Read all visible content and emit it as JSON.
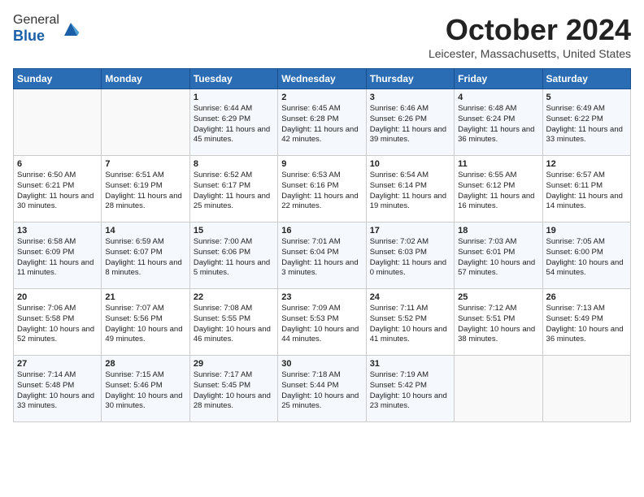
{
  "header": {
    "logo_general": "General",
    "logo_blue": "Blue",
    "month_title": "October 2024",
    "location": "Leicester, Massachusetts, United States"
  },
  "weekdays": [
    "Sunday",
    "Monday",
    "Tuesday",
    "Wednesday",
    "Thursday",
    "Friday",
    "Saturday"
  ],
  "weeks": [
    [
      {
        "day": "",
        "sunrise": "",
        "sunset": "",
        "daylight": ""
      },
      {
        "day": "",
        "sunrise": "",
        "sunset": "",
        "daylight": ""
      },
      {
        "day": "1",
        "sunrise": "Sunrise: 6:44 AM",
        "sunset": "Sunset: 6:29 PM",
        "daylight": "Daylight: 11 hours and 45 minutes."
      },
      {
        "day": "2",
        "sunrise": "Sunrise: 6:45 AM",
        "sunset": "Sunset: 6:28 PM",
        "daylight": "Daylight: 11 hours and 42 minutes."
      },
      {
        "day": "3",
        "sunrise": "Sunrise: 6:46 AM",
        "sunset": "Sunset: 6:26 PM",
        "daylight": "Daylight: 11 hours and 39 minutes."
      },
      {
        "day": "4",
        "sunrise": "Sunrise: 6:48 AM",
        "sunset": "Sunset: 6:24 PM",
        "daylight": "Daylight: 11 hours and 36 minutes."
      },
      {
        "day": "5",
        "sunrise": "Sunrise: 6:49 AM",
        "sunset": "Sunset: 6:22 PM",
        "daylight": "Daylight: 11 hours and 33 minutes."
      }
    ],
    [
      {
        "day": "6",
        "sunrise": "Sunrise: 6:50 AM",
        "sunset": "Sunset: 6:21 PM",
        "daylight": "Daylight: 11 hours and 30 minutes."
      },
      {
        "day": "7",
        "sunrise": "Sunrise: 6:51 AM",
        "sunset": "Sunset: 6:19 PM",
        "daylight": "Daylight: 11 hours and 28 minutes."
      },
      {
        "day": "8",
        "sunrise": "Sunrise: 6:52 AM",
        "sunset": "Sunset: 6:17 PM",
        "daylight": "Daylight: 11 hours and 25 minutes."
      },
      {
        "day": "9",
        "sunrise": "Sunrise: 6:53 AM",
        "sunset": "Sunset: 6:16 PM",
        "daylight": "Daylight: 11 hours and 22 minutes."
      },
      {
        "day": "10",
        "sunrise": "Sunrise: 6:54 AM",
        "sunset": "Sunset: 6:14 PM",
        "daylight": "Daylight: 11 hours and 19 minutes."
      },
      {
        "day": "11",
        "sunrise": "Sunrise: 6:55 AM",
        "sunset": "Sunset: 6:12 PM",
        "daylight": "Daylight: 11 hours and 16 minutes."
      },
      {
        "day": "12",
        "sunrise": "Sunrise: 6:57 AM",
        "sunset": "Sunset: 6:11 PM",
        "daylight": "Daylight: 11 hours and 14 minutes."
      }
    ],
    [
      {
        "day": "13",
        "sunrise": "Sunrise: 6:58 AM",
        "sunset": "Sunset: 6:09 PM",
        "daylight": "Daylight: 11 hours and 11 minutes."
      },
      {
        "day": "14",
        "sunrise": "Sunrise: 6:59 AM",
        "sunset": "Sunset: 6:07 PM",
        "daylight": "Daylight: 11 hours and 8 minutes."
      },
      {
        "day": "15",
        "sunrise": "Sunrise: 7:00 AM",
        "sunset": "Sunset: 6:06 PM",
        "daylight": "Daylight: 11 hours and 5 minutes."
      },
      {
        "day": "16",
        "sunrise": "Sunrise: 7:01 AM",
        "sunset": "Sunset: 6:04 PM",
        "daylight": "Daylight: 11 hours and 3 minutes."
      },
      {
        "day": "17",
        "sunrise": "Sunrise: 7:02 AM",
        "sunset": "Sunset: 6:03 PM",
        "daylight": "Daylight: 11 hours and 0 minutes."
      },
      {
        "day": "18",
        "sunrise": "Sunrise: 7:03 AM",
        "sunset": "Sunset: 6:01 PM",
        "daylight": "Daylight: 10 hours and 57 minutes."
      },
      {
        "day": "19",
        "sunrise": "Sunrise: 7:05 AM",
        "sunset": "Sunset: 6:00 PM",
        "daylight": "Daylight: 10 hours and 54 minutes."
      }
    ],
    [
      {
        "day": "20",
        "sunrise": "Sunrise: 7:06 AM",
        "sunset": "Sunset: 5:58 PM",
        "daylight": "Daylight: 10 hours and 52 minutes."
      },
      {
        "day": "21",
        "sunrise": "Sunrise: 7:07 AM",
        "sunset": "Sunset: 5:56 PM",
        "daylight": "Daylight: 10 hours and 49 minutes."
      },
      {
        "day": "22",
        "sunrise": "Sunrise: 7:08 AM",
        "sunset": "Sunset: 5:55 PM",
        "daylight": "Daylight: 10 hours and 46 minutes."
      },
      {
        "day": "23",
        "sunrise": "Sunrise: 7:09 AM",
        "sunset": "Sunset: 5:53 PM",
        "daylight": "Daylight: 10 hours and 44 minutes."
      },
      {
        "day": "24",
        "sunrise": "Sunrise: 7:11 AM",
        "sunset": "Sunset: 5:52 PM",
        "daylight": "Daylight: 10 hours and 41 minutes."
      },
      {
        "day": "25",
        "sunrise": "Sunrise: 7:12 AM",
        "sunset": "Sunset: 5:51 PM",
        "daylight": "Daylight: 10 hours and 38 minutes."
      },
      {
        "day": "26",
        "sunrise": "Sunrise: 7:13 AM",
        "sunset": "Sunset: 5:49 PM",
        "daylight": "Daylight: 10 hours and 36 minutes."
      }
    ],
    [
      {
        "day": "27",
        "sunrise": "Sunrise: 7:14 AM",
        "sunset": "Sunset: 5:48 PM",
        "daylight": "Daylight: 10 hours and 33 minutes."
      },
      {
        "day": "28",
        "sunrise": "Sunrise: 7:15 AM",
        "sunset": "Sunset: 5:46 PM",
        "daylight": "Daylight: 10 hours and 30 minutes."
      },
      {
        "day": "29",
        "sunrise": "Sunrise: 7:17 AM",
        "sunset": "Sunset: 5:45 PM",
        "daylight": "Daylight: 10 hours and 28 minutes."
      },
      {
        "day": "30",
        "sunrise": "Sunrise: 7:18 AM",
        "sunset": "Sunset: 5:44 PM",
        "daylight": "Daylight: 10 hours and 25 minutes."
      },
      {
        "day": "31",
        "sunrise": "Sunrise: 7:19 AM",
        "sunset": "Sunset: 5:42 PM",
        "daylight": "Daylight: 10 hours and 23 minutes."
      },
      {
        "day": "",
        "sunrise": "",
        "sunset": "",
        "daylight": ""
      },
      {
        "day": "",
        "sunrise": "",
        "sunset": "",
        "daylight": ""
      }
    ]
  ]
}
